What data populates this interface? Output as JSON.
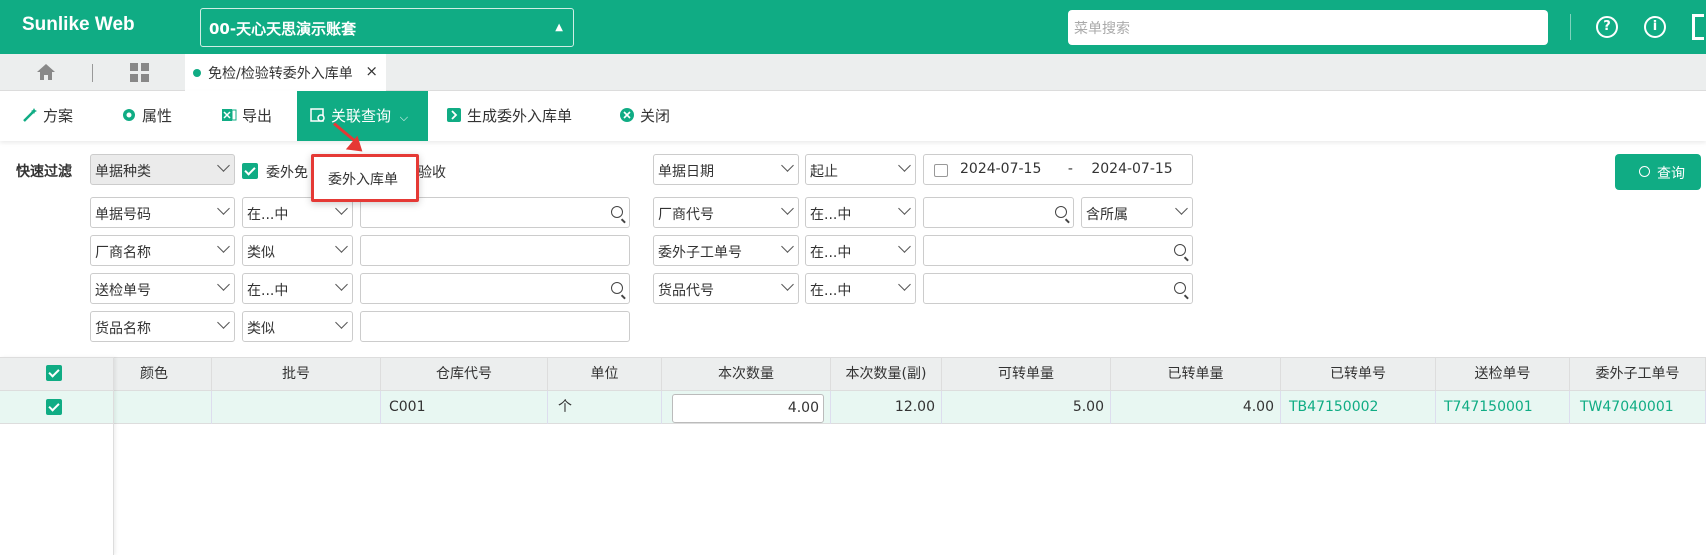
{
  "app": {
    "brand": "Sunlike Web",
    "account": "00-天心天思演示账套",
    "search_placeholder": "菜单搜索"
  },
  "tabs": {
    "doc_tab": "免检/检验转委外入库单",
    "close": "×"
  },
  "toolbar": {
    "scheme": "方案",
    "props": "属性",
    "export": "导出",
    "related_query": "关联查询",
    "generate": "生成委外入库单",
    "close": "关闭"
  },
  "dropdown": {
    "item": "委外入库单"
  },
  "filter": {
    "label": "快速过滤",
    "doc_kind": "单据种类",
    "cb1": "委外免",
    "cb2": "验收",
    "rows": [
      {
        "field": "单据号码",
        "op": "在...中"
      },
      {
        "field": "厂商名称",
        "op": "类似"
      },
      {
        "field": "送检单号",
        "op": "在...中"
      },
      {
        "field": "货品名称",
        "op": "类似"
      }
    ],
    "right_rows": [
      {
        "field": "单据日期",
        "op": "起止"
      },
      {
        "field": "厂商代号",
        "op": "在...中",
        "extra": "含所属"
      },
      {
        "field": "委外子工单号",
        "op": "在...中"
      },
      {
        "field": "货品代号",
        "op": "在...中"
      }
    ],
    "date_from": "2024-07-15",
    "date_sep": "-",
    "date_to": "2024-07-15",
    "query_button": "查询"
  },
  "grid": {
    "columns": [
      "颜色",
      "批号",
      "仓库代号",
      "单位",
      "本次数量",
      "本次数量(副)",
      "可转单量",
      "已转单量",
      "已转单号",
      "送检单号",
      "委外子工单号"
    ],
    "rows": [
      {
        "color": "",
        "batch": "",
        "wh": "C001",
        "unit": "个",
        "qty": "4.00",
        "qty2": "12.00",
        "avail": "5.00",
        "done": "4.00",
        "done_no": "TB47150002",
        "insp_no": "T747150001",
        "sub_no": "TW47040001"
      }
    ]
  }
}
